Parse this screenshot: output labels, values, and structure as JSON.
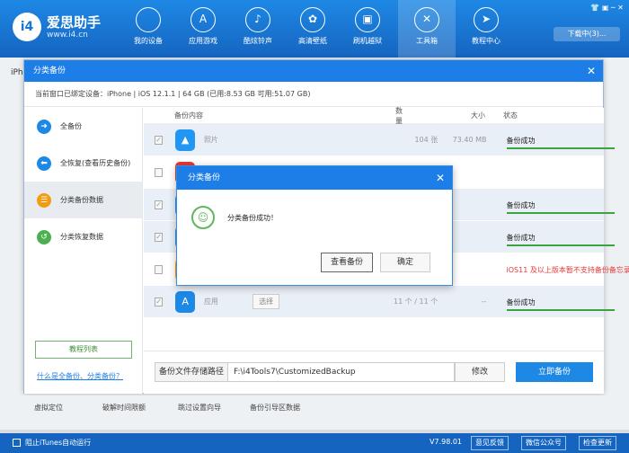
{
  "app": {
    "logo_mark": "i4",
    "title": "爱思助手",
    "url": "www.i4.cn",
    "nav": [
      {
        "label": "我的设备",
        "icon": "apple-icon",
        "glyph": ""
      },
      {
        "label": "应用游戏",
        "icon": "appstore-icon",
        "glyph": "A"
      },
      {
        "label": "酷炫铃声",
        "icon": "bell-icon",
        "glyph": "♪"
      },
      {
        "label": "高清壁纸",
        "icon": "flower-icon",
        "glyph": "✿"
      },
      {
        "label": "刷机越狱",
        "icon": "box-icon",
        "glyph": "▣"
      },
      {
        "label": "工具箱",
        "icon": "tools-icon",
        "glyph": "✕"
      },
      {
        "label": "教程中心",
        "icon": "compass-icon",
        "glyph": "➤"
      }
    ],
    "download_label": "下载中(3)...",
    "under_text": "iPh"
  },
  "dialog": {
    "title": "分类备份",
    "device_info": "当前窗口已绑定设备：iPhone | iOS 12.1.1 | 64 GB (已用:8.53 GB 可用:51.07 GB)",
    "sidebar": [
      {
        "label": "全备份",
        "icon": "arrow-right-icon",
        "color": "#1e88e5",
        "glyph": "➜"
      },
      {
        "label": "全恢复(查看历史备份)",
        "icon": "arrow-left-icon",
        "color": "#1e88e5",
        "glyph": "⬅"
      },
      {
        "label": "分类备份数据",
        "icon": "category-backup-icon",
        "color": "#f39c12",
        "glyph": "☰"
      },
      {
        "label": "分类恢复数据",
        "icon": "category-restore-icon",
        "color": "#4caf50",
        "glyph": "↺"
      }
    ],
    "tutorial_label": "教程列表",
    "help_link": "什么是全备份、分类备份？",
    "table": {
      "headers": [
        "备份内容",
        "数量",
        "大小",
        "状态"
      ],
      "rows": [
        {
          "name": "照片",
          "choose": "",
          "count": "104 张",
          "size": "73.40 MB",
          "status": "备份成功",
          "kind": "success",
          "checked": true,
          "icon_color": "#2196f3",
          "icon": "photos-icon",
          "glyph": "▲"
        },
        {
          "name": "",
          "choose": "",
          "count": "",
          "size": "",
          "status": "",
          "kind": "none",
          "checked": false,
          "icon_color": "#e53935",
          "icon": "music-icon",
          "glyph": "♪"
        },
        {
          "name": "",
          "choose": "",
          "count": "",
          "size": "",
          "status": "备份成功",
          "kind": "success",
          "checked": true,
          "icon_color": "#2196f3",
          "icon": "contacts-icon",
          "glyph": "☺"
        },
        {
          "name": "",
          "choose": "",
          "count": "",
          "size": "",
          "status": "备份成功",
          "kind": "success",
          "checked": true,
          "icon_color": "#2196f3",
          "icon": "messages-icon",
          "glyph": "✉"
        },
        {
          "name": "",
          "choose": "",
          "count": "",
          "size": "",
          "status": "iOS11 及以上版本暂不支持备份备忘录",
          "kind": "warn",
          "checked": false,
          "icon_color": "#ff9800",
          "icon": "notes-icon",
          "glyph": "✎"
        },
        {
          "name": "应用",
          "choose": "选择",
          "count": "11 个 / 11 个",
          "size": "--",
          "status": "备份成功",
          "kind": "success",
          "checked": true,
          "icon_color": "#1e88e5",
          "icon": "appstore-icon",
          "glyph": "A"
        }
      ]
    },
    "path_label": "备份文件存储路径",
    "path_value": "F:\\i4Tools7\\CustomizedBackup",
    "modify_label": "修改",
    "backup_label": "立即备份"
  },
  "modal": {
    "title": "分类备份",
    "message": "分类备份成功！",
    "view_label": "查看备份",
    "ok_label": "确定"
  },
  "shortcuts": [
    "虚拟定位",
    "破解时间限额",
    "跳过设置向导",
    "备份引导区数据"
  ],
  "statusbar": {
    "itunes_label": "阻止iTunes自动运行",
    "version": "V7.98.01",
    "feedback_label": "意见反馈",
    "wechat_label": "微信公众号",
    "update_label": "检查更新"
  }
}
